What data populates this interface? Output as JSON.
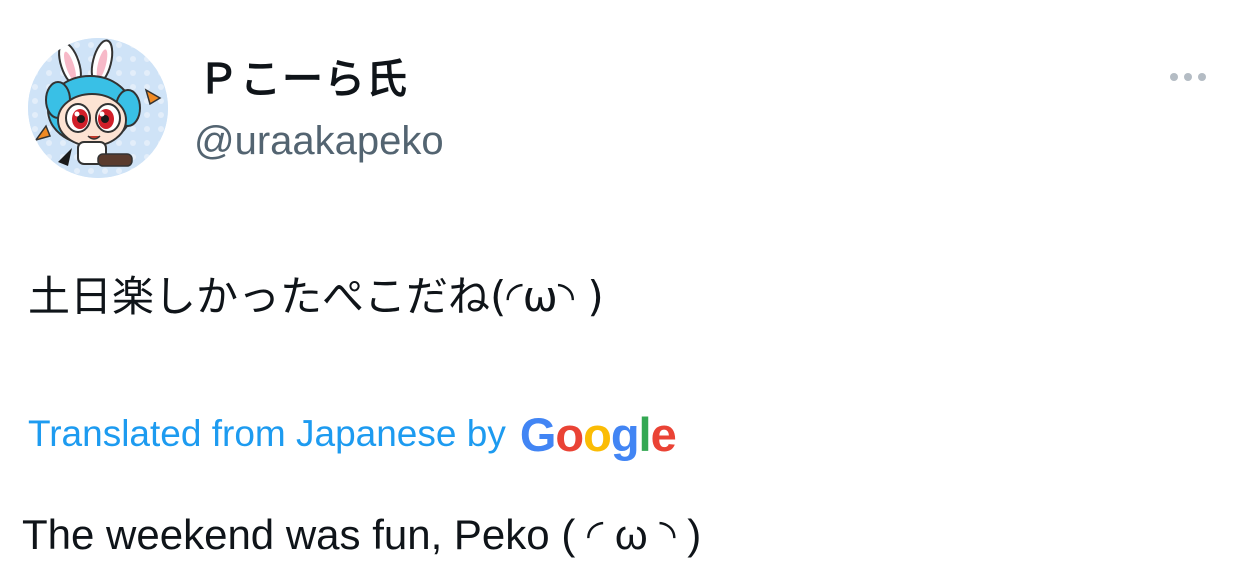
{
  "tweet": {
    "author": {
      "display_name": "Ｐこーら氏",
      "handle": "@uraakapeko"
    },
    "text": "土日楽しかったぺこだね(◜ω◝ )",
    "translation": {
      "label": "Translated from Japanese by",
      "provider_letters": [
        "G",
        "o",
        "o",
        "g",
        "l",
        "e"
      ],
      "text": "The weekend was fun, Peko ( ◜ ω ◝ )"
    }
  },
  "colors": {
    "link": "#1d9bf0",
    "handle": "#536471",
    "text": "#0f1419",
    "google": [
      "#4285F4",
      "#EA4335",
      "#FBBC05",
      "#4285F4",
      "#34A853",
      "#EA4335"
    ]
  },
  "icons": {
    "more": "more-horizontal-icon"
  }
}
